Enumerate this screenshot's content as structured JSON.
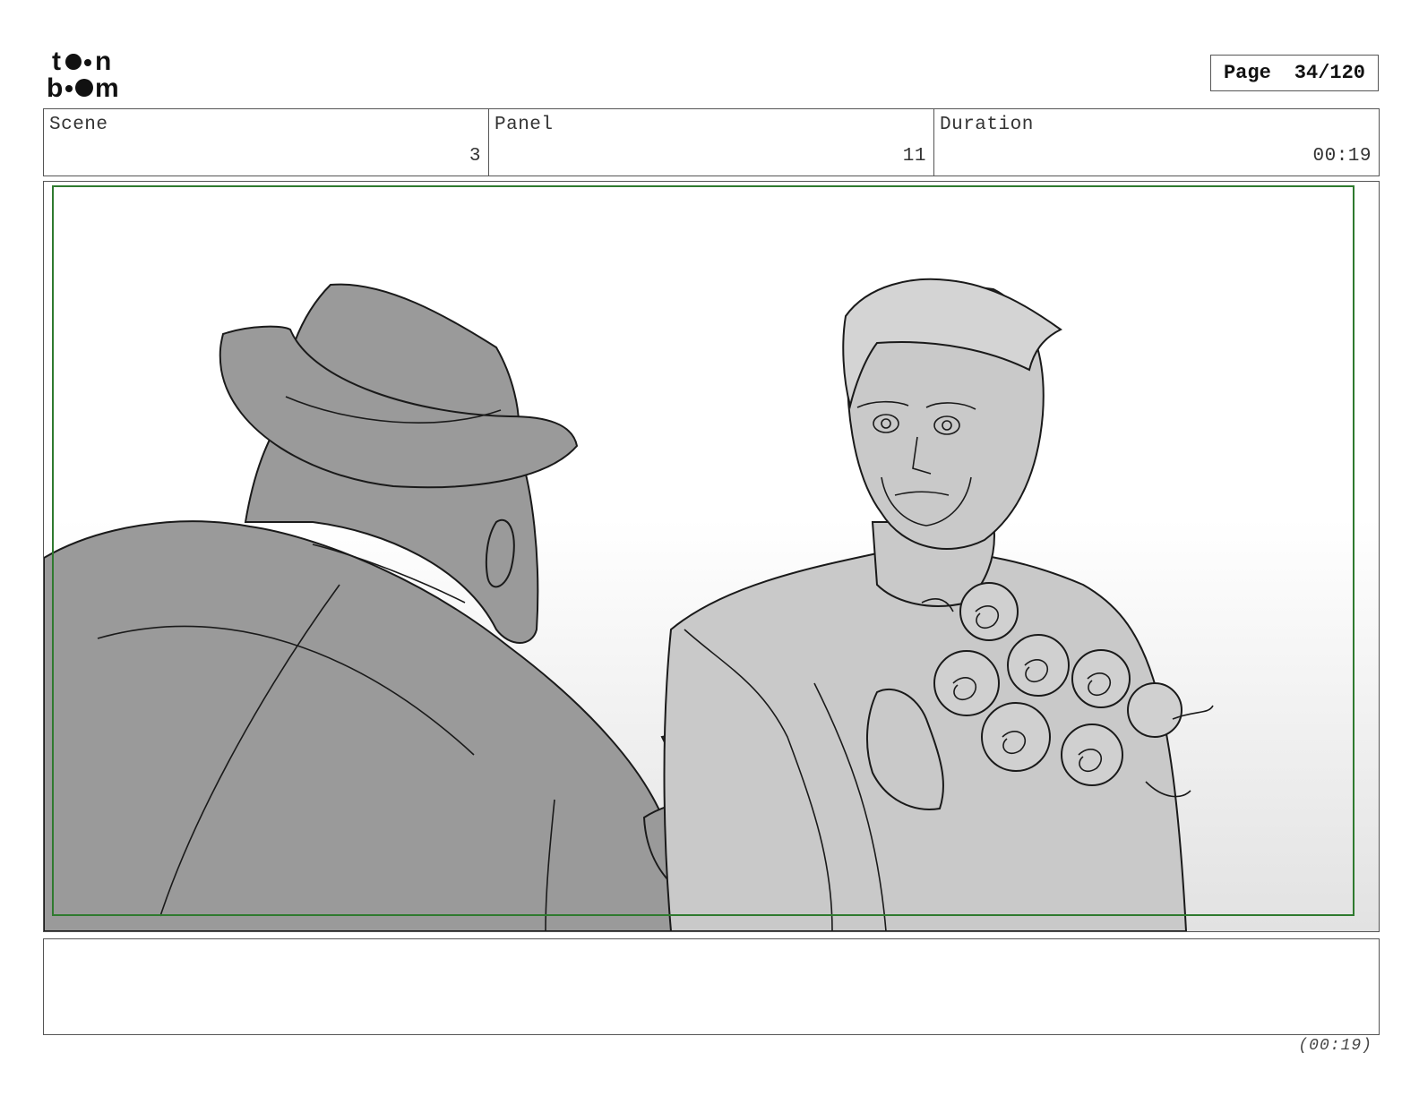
{
  "logo": {
    "line1": "toon",
    "line2": "boom",
    "icon": "toon-boom-logo"
  },
  "page_indicator": {
    "label": "Page",
    "value": "34/120"
  },
  "info": {
    "scene_label": "Scene",
    "scene_value": "3",
    "panel_label": "Panel",
    "panel_value": "11",
    "duration_label": "Duration",
    "duration_value": "00:19"
  },
  "notes": {
    "text": ""
  },
  "footer": {
    "duration": "(00:19)"
  },
  "colors": {
    "safe_frame": "#2f7a2f",
    "dark_figure": "#9a9a9a",
    "light_figure": "#c9c9c9",
    "line": "#1a1a1a"
  }
}
